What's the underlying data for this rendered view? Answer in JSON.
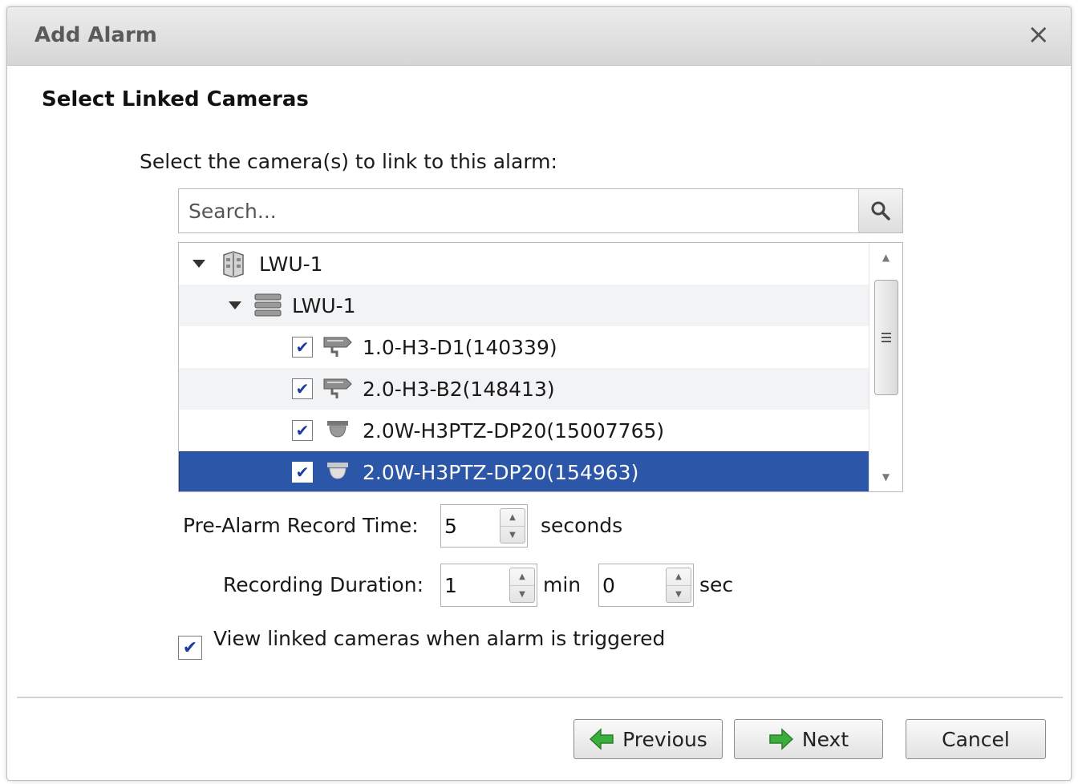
{
  "window": {
    "title": "Add Alarm",
    "close_glyph": "×"
  },
  "section_title": "Select Linked Cameras",
  "instruction": "Select the camera(s) to link to this alarm:",
  "search": {
    "placeholder": "Search...",
    "value": "",
    "icon": "search-icon"
  },
  "tree": {
    "items": [
      {
        "label": "LWU-1",
        "icon": "site-icon",
        "expanded": true
      },
      {
        "label": "LWU-1",
        "icon": "server-icon",
        "expanded": true
      },
      {
        "label": "1.0-H3-D1(140339)",
        "icon": "bullet-camera-icon",
        "checked": true
      },
      {
        "label": "2.0-H3-B2(148413)",
        "icon": "bullet-camera-icon",
        "checked": true
      },
      {
        "label": "2.0W-H3PTZ-DP20(15007765)",
        "icon": "ptz-dome-camera-icon",
        "checked": true
      },
      {
        "label": "2.0W-H3PTZ-DP20(154963)",
        "icon": "ptz-dome-camera-icon",
        "checked": true,
        "selected": true
      }
    ],
    "selection_color": "#2c57a8"
  },
  "pre_alarm": {
    "label": "Pre-Alarm Record Time:",
    "value": "5",
    "unit": "seconds"
  },
  "recording_duration": {
    "label": "Recording Duration:",
    "min_value": "1",
    "min_unit": "min",
    "sec_value": "0",
    "sec_unit": "sec"
  },
  "view_linked": {
    "label": "View linked cameras when alarm is triggered",
    "checked": true
  },
  "buttons": {
    "previous": "Previous",
    "next": "Next",
    "cancel": "Cancel"
  },
  "colors": {
    "arrow_green": "#3cae3c",
    "checkmark": "#1b3e9e"
  }
}
